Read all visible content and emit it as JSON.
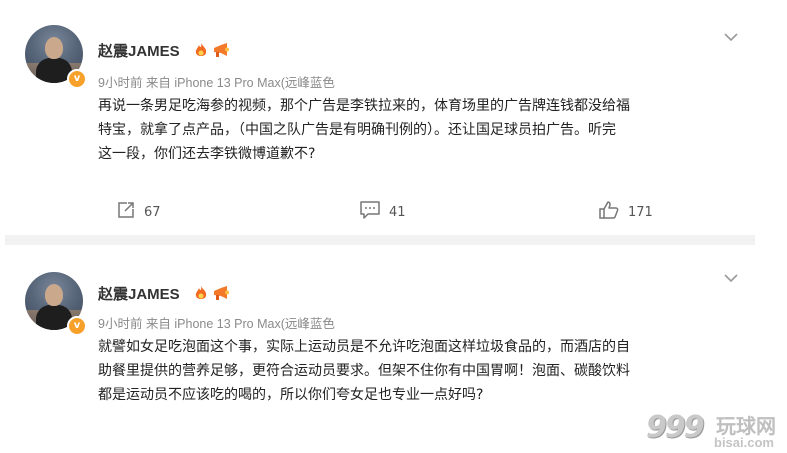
{
  "posts": [
    {
      "username": "赵震JAMES",
      "meta": "9小时前 来自 iPhone 13 Pro Max(远峰蓝色",
      "body_lines": [
        "再说一条男足吃海参的视频，那个广告是李铁拉来的，体育场里的广告牌连钱都没给福",
        "特宝，就拿了点产品，（中国之队广告是有明确刊例的）。还让国足球员拍广告。听完",
        "这一段，你们还去李铁微博道歉不?"
      ],
      "reposts": "67",
      "comments": "41",
      "likes": "171"
    },
    {
      "username": "赵震JAMES",
      "meta": "9小时前 来自 iPhone 13 Pro Max(远峰蓝色",
      "body_lines": [
        "就譬如女足吃泡面这个事，实际上运动员是不允许吃泡面这样垃圾食品的，而酒店的自",
        "助餐里提供的营养足够，更符合运动员要求。但架不住你有中国胃啊！泡面、碳酸饮料",
        "都是运动员不应该吃的喝的，所以你们夸女足也专业一点好吗?"
      ]
    }
  ],
  "verified_badge": "v",
  "watermark": {
    "digits": "999",
    "name": "玩球网",
    "url": "bisai.com"
  },
  "icons": [
    "repost-icon",
    "comment-icon",
    "like-icon",
    "chevron-down-icon",
    "verified-badge-icon",
    "flame-emoji-icon",
    "megaphone-emoji-icon"
  ],
  "colors": {
    "verified": "#f7a12b",
    "meta_text": "#8a8a8a",
    "divider": "#f2f2f2"
  }
}
